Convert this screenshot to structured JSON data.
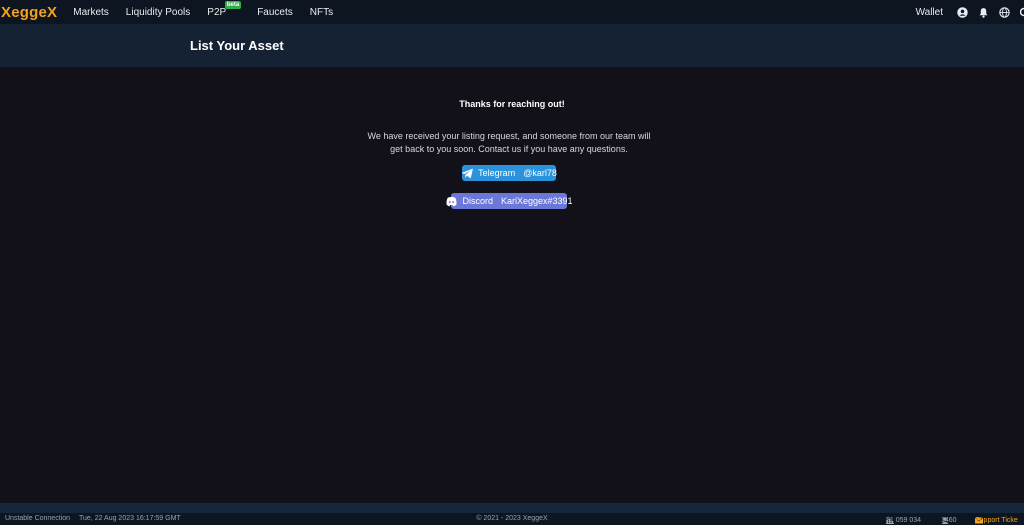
{
  "app": {
    "logo": "XeggeX"
  },
  "nav": {
    "items": [
      {
        "label": "Markets"
      },
      {
        "label": "Liquidity Pools"
      },
      {
        "label": "P2P",
        "badge": "beta"
      },
      {
        "label": "Faucets"
      },
      {
        "label": "NFTs"
      }
    ],
    "wallet_label": "Wallet",
    "icons": [
      "user-circle-icon",
      "bell-icon",
      "globe-icon"
    ]
  },
  "header": {
    "title": "List Your Asset"
  },
  "main": {
    "thanks": "Thanks for reaching out!",
    "message_line1": "We have received your listing request, and someone from our team will",
    "message_line2": "get back to you soon. Contact us if you have any questions.",
    "telegram": {
      "name": "Telegram",
      "handle": "@karl78",
      "color": "#2b93db"
    },
    "discord": {
      "name": "Discord",
      "handle": "KarlXeggex#3391",
      "color": "#6c78d8"
    }
  },
  "footer": {
    "connection": "Unstable Connection",
    "timestamp": "Tue, 22 Aug 2023 16:17:59 GMT",
    "copyright": "© 2021 - 2023 XeggeX",
    "volume": "$1 059 034",
    "users": "1460",
    "support": "Support Ticke"
  },
  "colors": {
    "accent": "#f4a21f",
    "background": "#121018",
    "nav_bg": "#0c1520",
    "header_bg": "#152233",
    "beta_green": "#2fae4c"
  }
}
